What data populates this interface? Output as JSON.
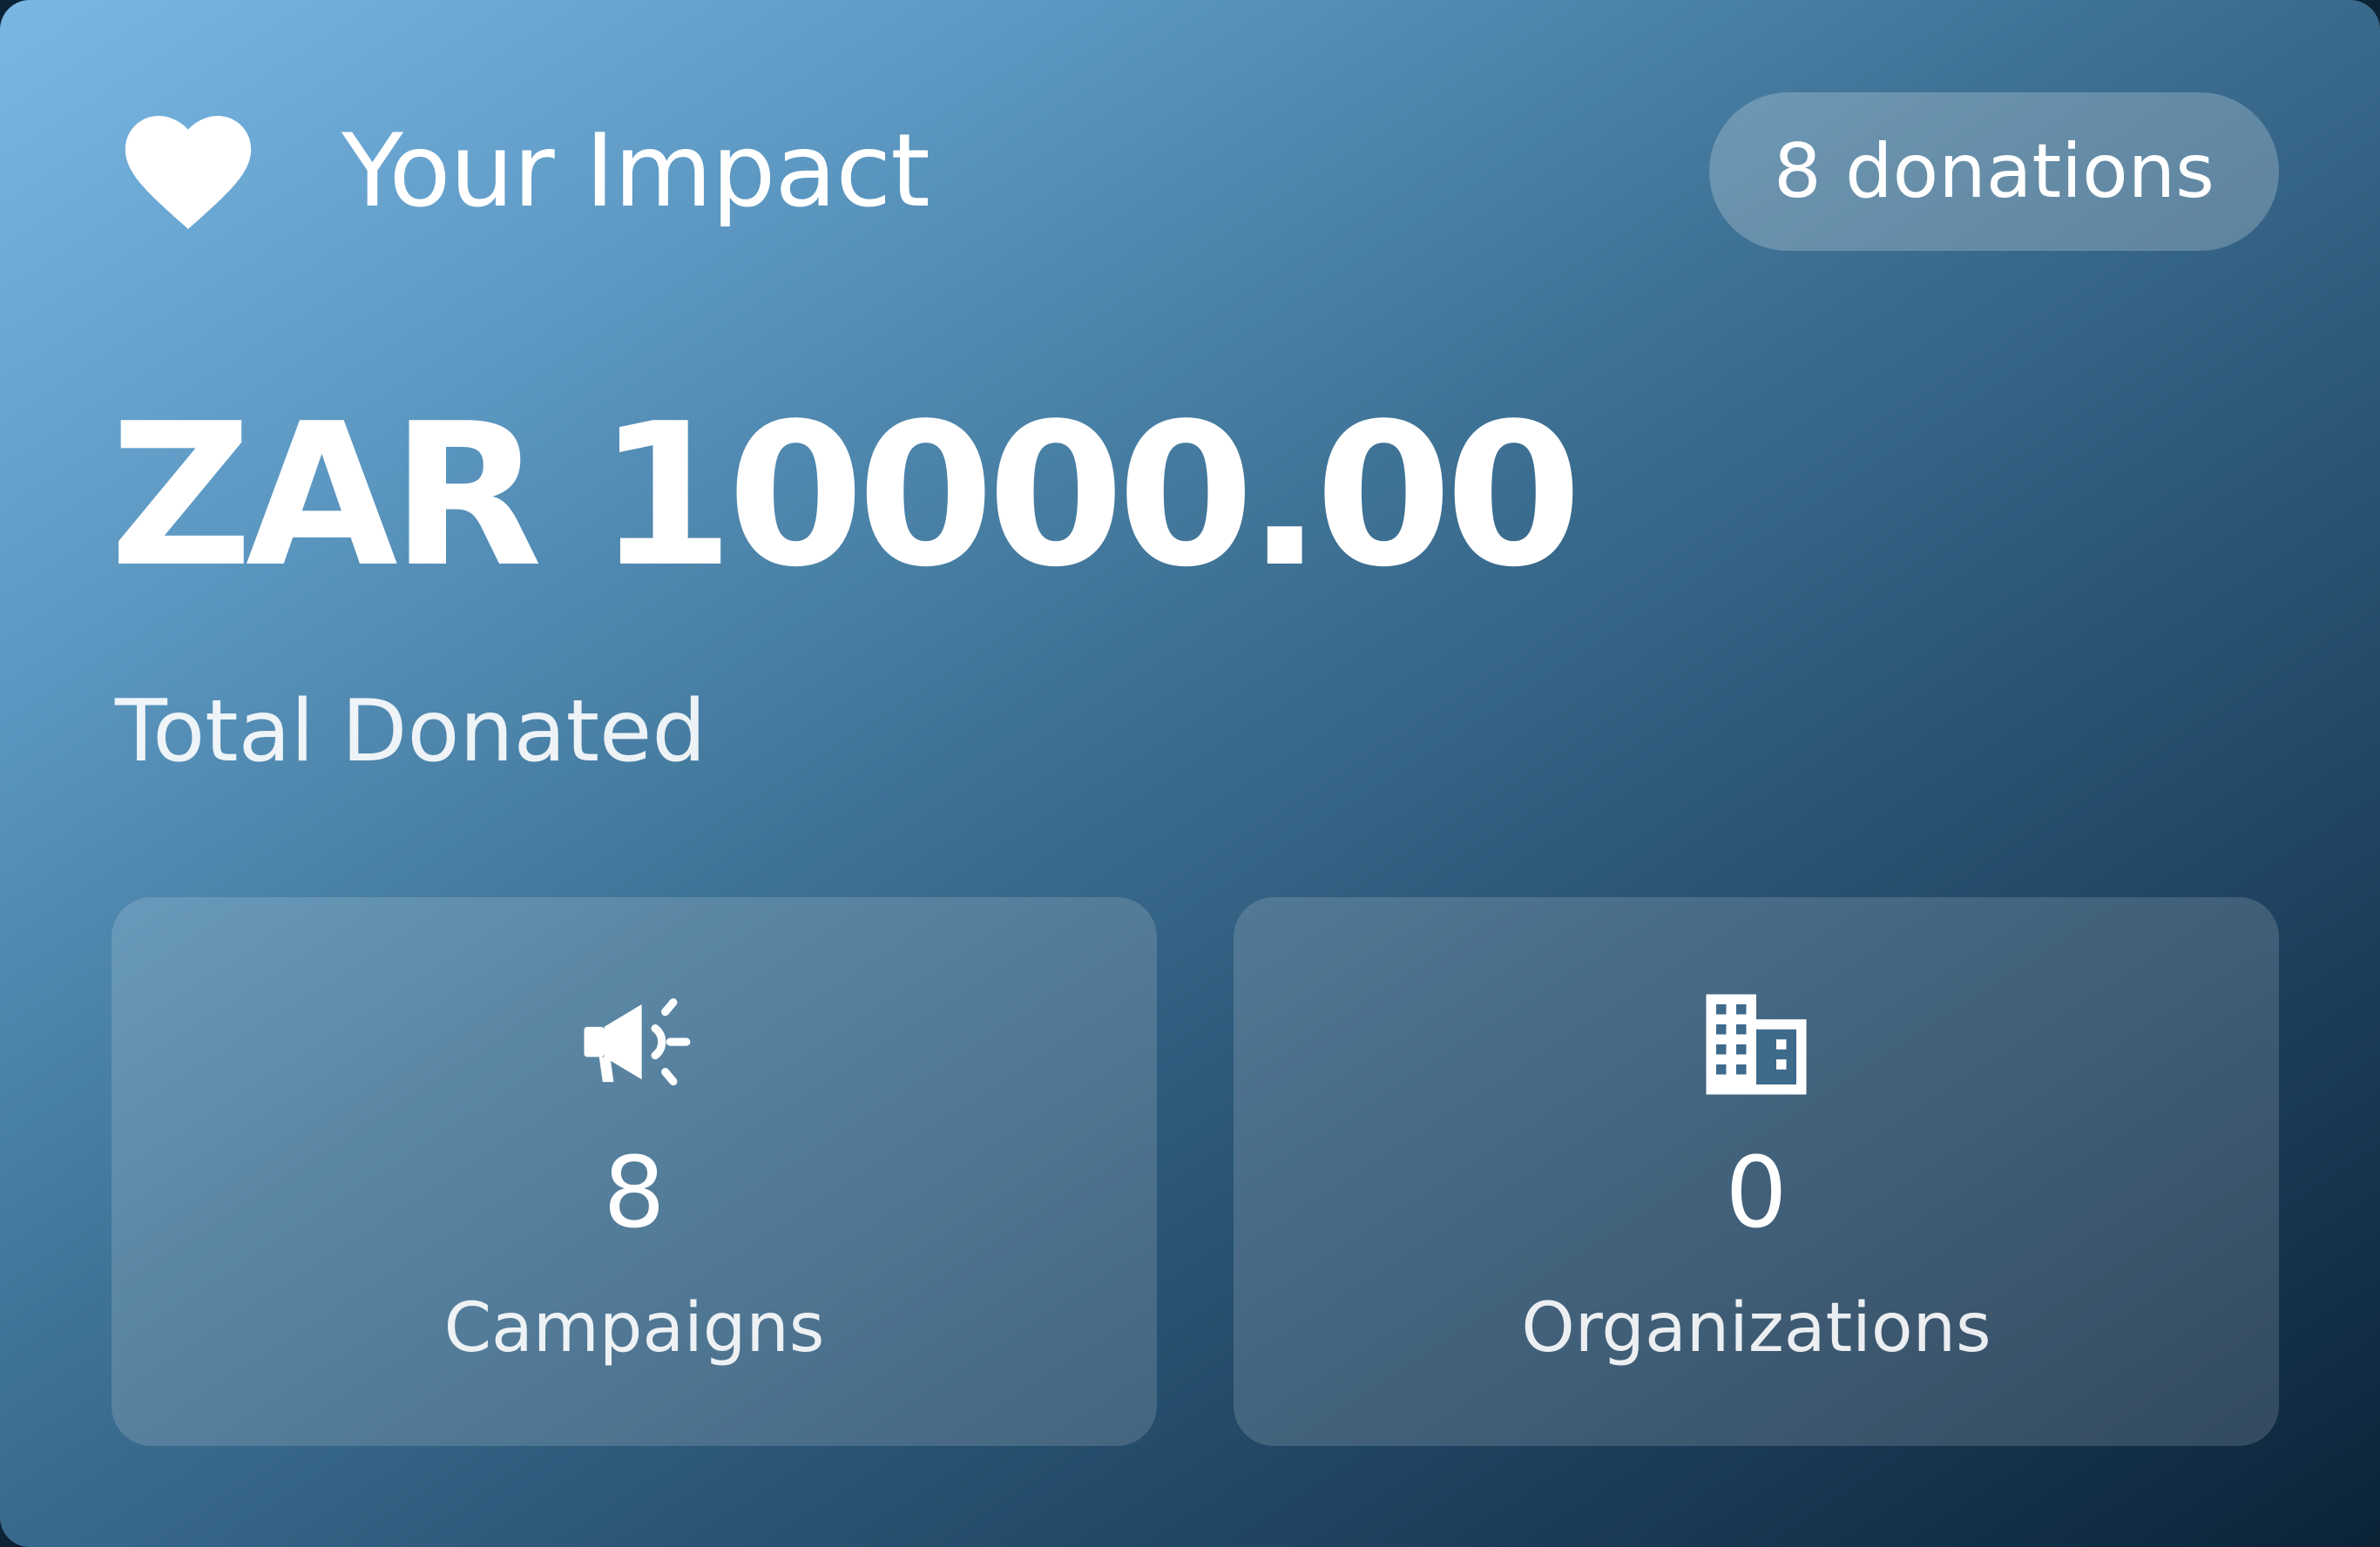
{
  "header": {
    "icon": "heart-icon",
    "title": "Your Impact",
    "donations_badge": "8 donations"
  },
  "total": {
    "amount": "ZAR 10000.00",
    "label": "Total Donated"
  },
  "stats": [
    {
      "icon": "megaphone-icon",
      "value": "8",
      "label": "Campaigns"
    },
    {
      "icon": "building-icon",
      "value": "0",
      "label": "Organizations"
    }
  ],
  "colors": {
    "gradient_start": "#7ab7e3",
    "gradient_end": "#0b2338",
    "text": "#ffffff"
  }
}
